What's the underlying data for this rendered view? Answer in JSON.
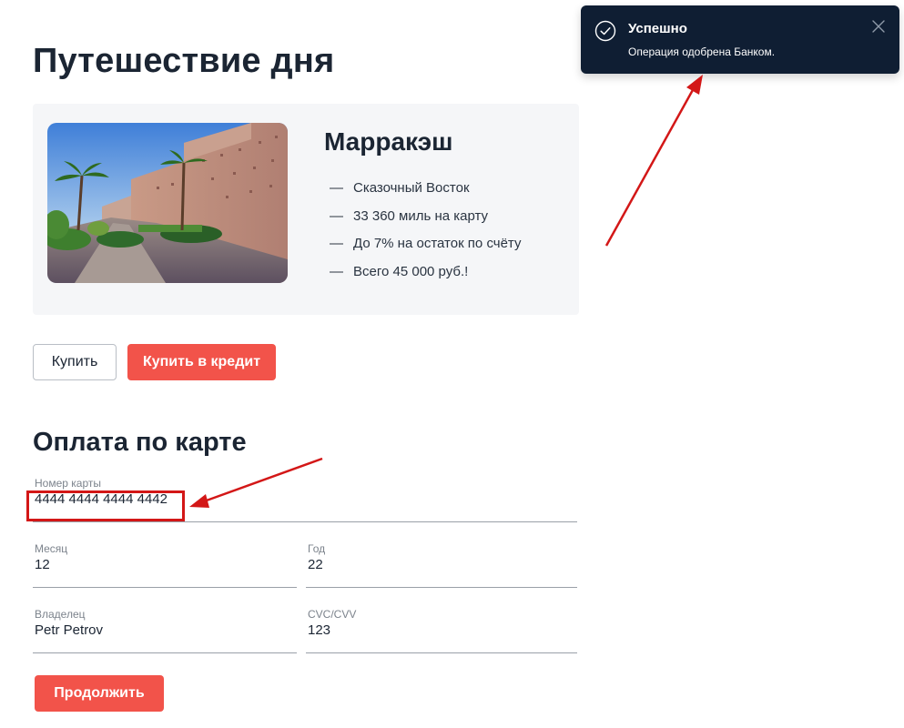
{
  "page": {
    "title": "Путешествие дня"
  },
  "offer": {
    "city": "Марракэш",
    "features": [
      "Сказочный Восток",
      "33 360 миль на карту",
      "До 7% на остаток по счёту",
      "Всего 45 000 руб.!"
    ],
    "dash": "—"
  },
  "actions": {
    "buy_label": "Купить",
    "buy_credit_label": "Купить в кредит"
  },
  "payment": {
    "section_title": "Оплата по карте",
    "card_number": {
      "label": "Номер карты",
      "value": "4444 4444 4444 4442"
    },
    "month": {
      "label": "Месяц",
      "value": "12"
    },
    "year": {
      "label": "Год",
      "value": "22"
    },
    "owner": {
      "label": "Владелец",
      "value": "Petr Petrov"
    },
    "cvc": {
      "label": "CVC/CVV",
      "value": "123"
    },
    "continue_label": "Продолжить"
  },
  "notification": {
    "title": "Успешно",
    "message": "Операция одобрена Банком.",
    "icon": "check-circle-icon",
    "close_icon": "close-icon"
  },
  "colors": {
    "accent_red": "#f2534a",
    "toast_bg": "#0f1e33",
    "annotation_red": "#d31717",
    "text_dark": "#1b2533"
  }
}
